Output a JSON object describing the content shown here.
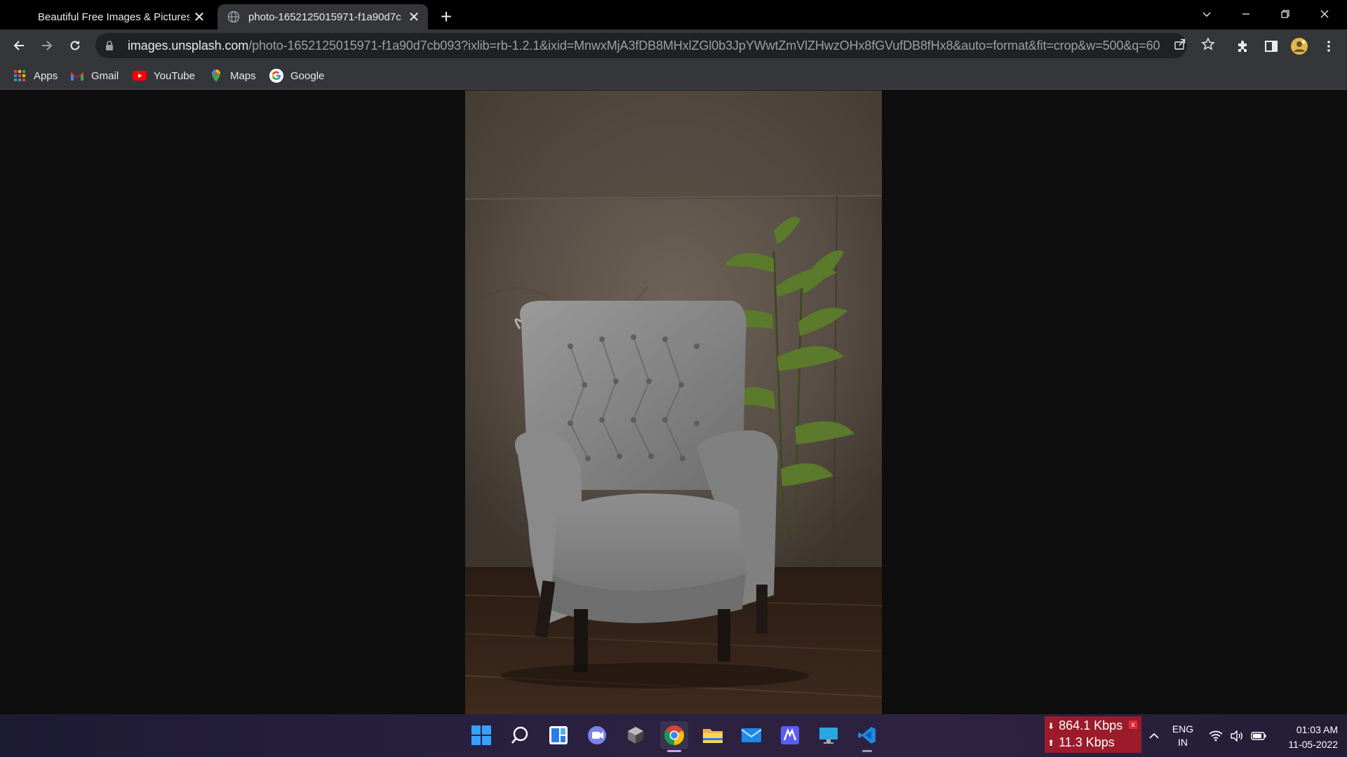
{
  "browser": {
    "tabs": [
      {
        "title": "Beautiful Free Images & Pictures",
        "active": false
      },
      {
        "title": "photo-1652125015971-f1a90d7c",
        "active": true
      }
    ],
    "url_host": "images.unsplash.com",
    "url_path": "/photo-1652125015971-f1a90d7cb093?ixlib=rb-1.2.1&ixid=MnwxMjA3fDB8MHxlZGl0b3JpYWwtZmVlZHwzOHx8fGVufDB8fHx8&auto=format&fit=crop&w=500&q=60",
    "bookmarks": [
      "Apps",
      "Gmail",
      "YouTube",
      "Maps",
      "Google"
    ]
  },
  "content": {
    "image_alt": "Grey tufted armchair beside a plant"
  },
  "taskbar": {
    "apps": [
      "start-icon",
      "search-icon",
      "widgets-icon",
      "teams-chat-icon",
      "app-icon",
      "chrome-icon",
      "file-explorer-icon",
      "mail-icon",
      "editor-icon",
      "remote-desktop-icon",
      "vscode-icon"
    ],
    "active_app": "chrome-icon",
    "net_down": "864.1 Kbps",
    "net_up": "11.3 Kbps",
    "lang_top": "ENG",
    "lang_bottom": "IN",
    "time": "01:03 AM",
    "date": "11-05-2022"
  },
  "colors": {
    "tab_bg": "#35363a",
    "titlebar_bg": "#000000",
    "omnibox_bg": "#202124",
    "netspeed_bg": "#9b1b2b"
  }
}
